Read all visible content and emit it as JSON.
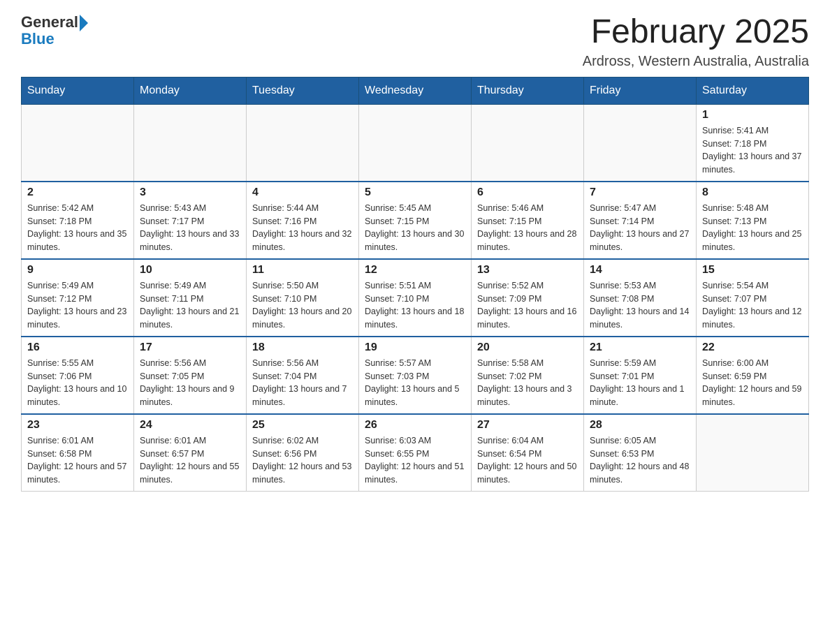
{
  "header": {
    "logo": {
      "general": "General",
      "blue": "Blue"
    },
    "title": "February 2025",
    "location": "Ardross, Western Australia, Australia"
  },
  "weekdays": [
    "Sunday",
    "Monday",
    "Tuesday",
    "Wednesday",
    "Thursday",
    "Friday",
    "Saturday"
  ],
  "weeks": [
    [
      {
        "day": "",
        "info": ""
      },
      {
        "day": "",
        "info": ""
      },
      {
        "day": "",
        "info": ""
      },
      {
        "day": "",
        "info": ""
      },
      {
        "day": "",
        "info": ""
      },
      {
        "day": "",
        "info": ""
      },
      {
        "day": "1",
        "info": "Sunrise: 5:41 AM\nSunset: 7:18 PM\nDaylight: 13 hours and 37 minutes."
      }
    ],
    [
      {
        "day": "2",
        "info": "Sunrise: 5:42 AM\nSunset: 7:18 PM\nDaylight: 13 hours and 35 minutes."
      },
      {
        "day": "3",
        "info": "Sunrise: 5:43 AM\nSunset: 7:17 PM\nDaylight: 13 hours and 33 minutes."
      },
      {
        "day": "4",
        "info": "Sunrise: 5:44 AM\nSunset: 7:16 PM\nDaylight: 13 hours and 32 minutes."
      },
      {
        "day": "5",
        "info": "Sunrise: 5:45 AM\nSunset: 7:15 PM\nDaylight: 13 hours and 30 minutes."
      },
      {
        "day": "6",
        "info": "Sunrise: 5:46 AM\nSunset: 7:15 PM\nDaylight: 13 hours and 28 minutes."
      },
      {
        "day": "7",
        "info": "Sunrise: 5:47 AM\nSunset: 7:14 PM\nDaylight: 13 hours and 27 minutes."
      },
      {
        "day": "8",
        "info": "Sunrise: 5:48 AM\nSunset: 7:13 PM\nDaylight: 13 hours and 25 minutes."
      }
    ],
    [
      {
        "day": "9",
        "info": "Sunrise: 5:49 AM\nSunset: 7:12 PM\nDaylight: 13 hours and 23 minutes."
      },
      {
        "day": "10",
        "info": "Sunrise: 5:49 AM\nSunset: 7:11 PM\nDaylight: 13 hours and 21 minutes."
      },
      {
        "day": "11",
        "info": "Sunrise: 5:50 AM\nSunset: 7:10 PM\nDaylight: 13 hours and 20 minutes."
      },
      {
        "day": "12",
        "info": "Sunrise: 5:51 AM\nSunset: 7:10 PM\nDaylight: 13 hours and 18 minutes."
      },
      {
        "day": "13",
        "info": "Sunrise: 5:52 AM\nSunset: 7:09 PM\nDaylight: 13 hours and 16 minutes."
      },
      {
        "day": "14",
        "info": "Sunrise: 5:53 AM\nSunset: 7:08 PM\nDaylight: 13 hours and 14 minutes."
      },
      {
        "day": "15",
        "info": "Sunrise: 5:54 AM\nSunset: 7:07 PM\nDaylight: 13 hours and 12 minutes."
      }
    ],
    [
      {
        "day": "16",
        "info": "Sunrise: 5:55 AM\nSunset: 7:06 PM\nDaylight: 13 hours and 10 minutes."
      },
      {
        "day": "17",
        "info": "Sunrise: 5:56 AM\nSunset: 7:05 PM\nDaylight: 13 hours and 9 minutes."
      },
      {
        "day": "18",
        "info": "Sunrise: 5:56 AM\nSunset: 7:04 PM\nDaylight: 13 hours and 7 minutes."
      },
      {
        "day": "19",
        "info": "Sunrise: 5:57 AM\nSunset: 7:03 PM\nDaylight: 13 hours and 5 minutes."
      },
      {
        "day": "20",
        "info": "Sunrise: 5:58 AM\nSunset: 7:02 PM\nDaylight: 13 hours and 3 minutes."
      },
      {
        "day": "21",
        "info": "Sunrise: 5:59 AM\nSunset: 7:01 PM\nDaylight: 13 hours and 1 minute."
      },
      {
        "day": "22",
        "info": "Sunrise: 6:00 AM\nSunset: 6:59 PM\nDaylight: 12 hours and 59 minutes."
      }
    ],
    [
      {
        "day": "23",
        "info": "Sunrise: 6:01 AM\nSunset: 6:58 PM\nDaylight: 12 hours and 57 minutes."
      },
      {
        "day": "24",
        "info": "Sunrise: 6:01 AM\nSunset: 6:57 PM\nDaylight: 12 hours and 55 minutes."
      },
      {
        "day": "25",
        "info": "Sunrise: 6:02 AM\nSunset: 6:56 PM\nDaylight: 12 hours and 53 minutes."
      },
      {
        "day": "26",
        "info": "Sunrise: 6:03 AM\nSunset: 6:55 PM\nDaylight: 12 hours and 51 minutes."
      },
      {
        "day": "27",
        "info": "Sunrise: 6:04 AM\nSunset: 6:54 PM\nDaylight: 12 hours and 50 minutes."
      },
      {
        "day": "28",
        "info": "Sunrise: 6:05 AM\nSunset: 6:53 PM\nDaylight: 12 hours and 48 minutes."
      },
      {
        "day": "",
        "info": ""
      }
    ]
  ]
}
